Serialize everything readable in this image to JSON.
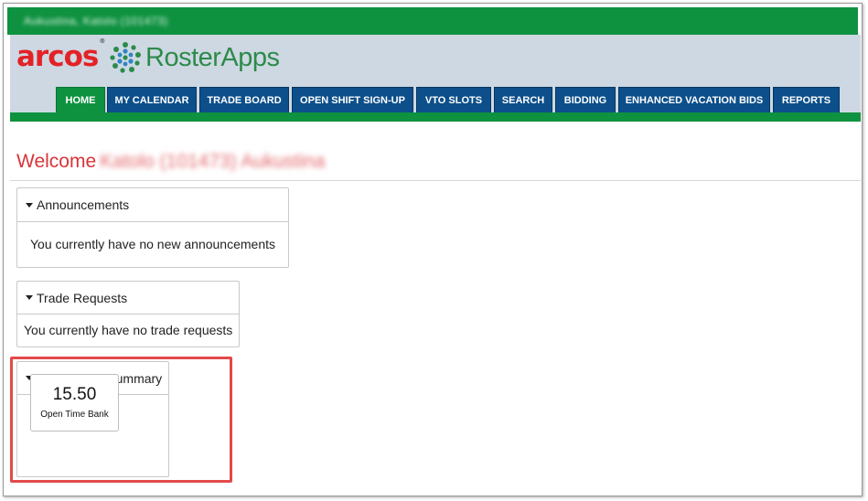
{
  "topbar": {
    "user_name": "Aukustina, Katolo (101473)"
  },
  "header": {
    "logo_primary": "arcos",
    "logo_secondary": "RosterApps"
  },
  "nav": {
    "tabs": [
      {
        "label": "HOME"
      },
      {
        "label": "MY CALENDAR"
      },
      {
        "label": "TRADE BOARD"
      },
      {
        "label": "OPEN SHIFT SIGN-UP"
      },
      {
        "label": "VTO SLOTS"
      },
      {
        "label": "SEARCH"
      },
      {
        "label": "BIDDING"
      },
      {
        "label": "ENHANCED VACATION BIDS"
      },
      {
        "label": "REPORTS"
      }
    ]
  },
  "welcome": {
    "label": "Welcome",
    "name": "Katolo (101473) Aukustina"
  },
  "announcements": {
    "title": "Announcements",
    "message": "You currently have no new announcements"
  },
  "trade_requests": {
    "title": "Trade Requests",
    "message": "You currently have no trade requests"
  },
  "time_banks": {
    "title": "Time Banks Summary",
    "banks": [
      {
        "value": "15.50",
        "label": "Open Time Bank"
      }
    ]
  },
  "colors": {
    "green": "#0e9240",
    "nav_blue": "#0c4f8a",
    "header_bg": "#cdd8e2",
    "accent_red": "#d9343a",
    "highlight": "#e24a4a"
  }
}
